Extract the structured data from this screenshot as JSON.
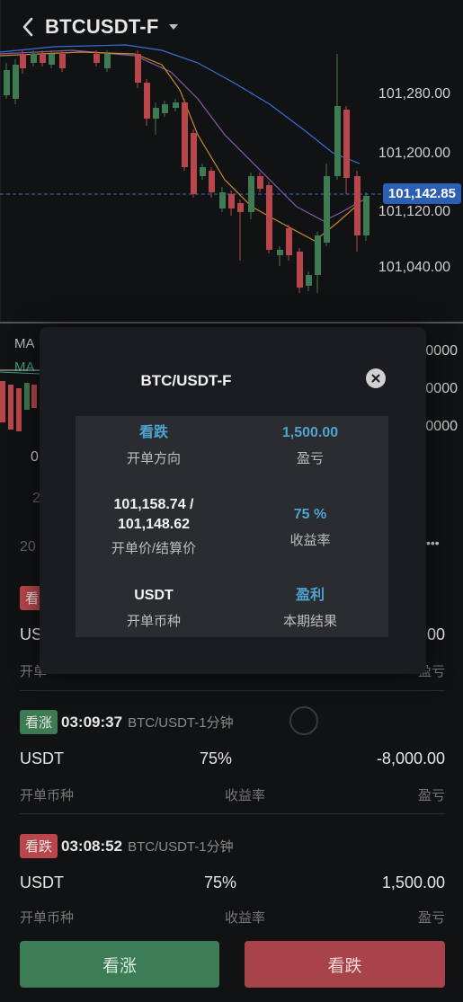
{
  "header": {
    "title": "BTCUSDT-F"
  },
  "chart": {
    "price_levels": [
      "101,280.00",
      "101,200.00",
      "101,120.00",
      "101,040.00"
    ],
    "current_price": "101,142.85"
  },
  "indicator": {
    "ma_labels": [
      "MA",
      "MA"
    ],
    "scale_values": [
      "0000",
      "0000",
      "0000"
    ]
  },
  "background_peek": {
    "text_a": "0",
    "text_b": "2",
    "text_c": "20",
    "more": "•••"
  },
  "trades": [
    {
      "badge": "看",
      "direction": "down",
      "currency": "USD",
      "pnl": ".00",
      "label_currency": "开单",
      "label_pnl": "盈亏"
    },
    {
      "badge": "看涨",
      "direction": "up",
      "time": "03:09:37",
      "pair": "BTC/USDT-1分钟",
      "currency": "USDT",
      "rate": "75%",
      "pnl": "-8,000.00",
      "label_currency": "开单币种",
      "label_rate": "收益率",
      "label_pnl": "盈亏"
    },
    {
      "badge": "看跌",
      "direction": "down",
      "time": "03:08:52",
      "pair": "BTC/USDT-1分钟",
      "currency": "USDT",
      "rate": "75%",
      "pnl": "1,500.00",
      "label_currency": "开单币种",
      "label_rate": "收益率",
      "label_pnl": "盈亏"
    }
  ],
  "buttons": {
    "up": "看涨",
    "down": "看跌"
  },
  "modal": {
    "title": "BTC/USDT-F",
    "cells": [
      {
        "value": "看跌",
        "label": "开单方向"
      },
      {
        "value": "1,500.00",
        "label": "盈亏"
      },
      {
        "value": "101,158.74 /",
        "value2": "101,148.62",
        "label": "开单价/结算价"
      },
      {
        "value": "75 %",
        "label": "收益率"
      },
      {
        "value": "USDT",
        "label": "开单币种"
      },
      {
        "value": "盈利",
        "label": "本期结果"
      }
    ]
  },
  "colors": {
    "up": "#3e7a52",
    "down": "#b8464b",
    "accent_blue": "#4fa3d1",
    "price_tag": "#2c5fb3"
  }
}
